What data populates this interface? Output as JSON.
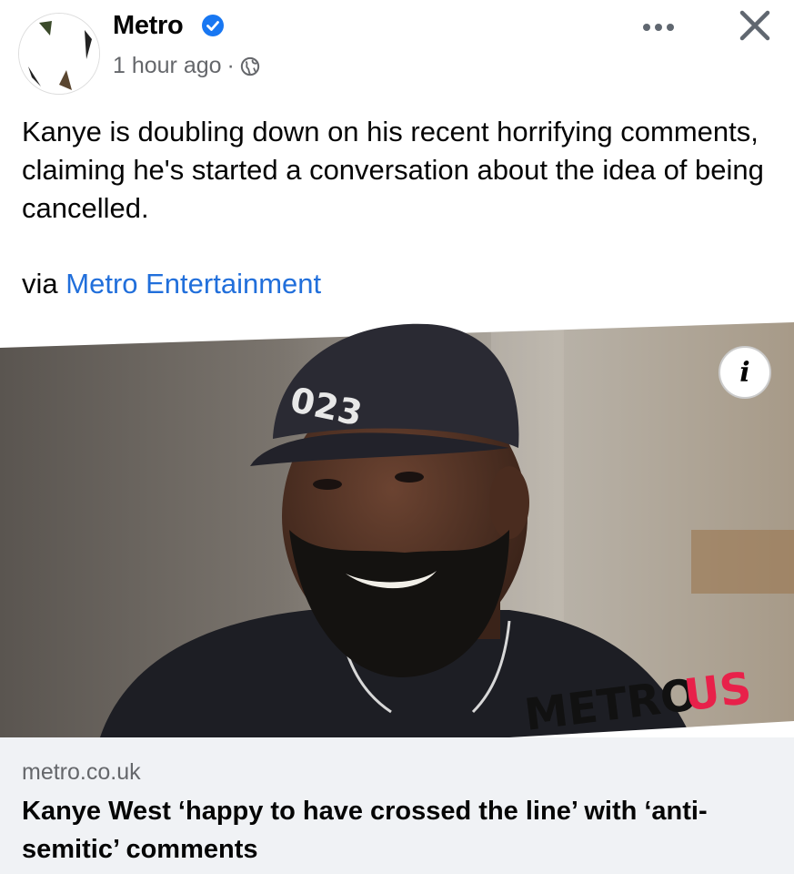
{
  "post": {
    "page_name": "Metro",
    "time": "1 hour ago",
    "separator": "·",
    "text": "Kanye is doubling down on his recent horrifying comments, claiming he's started a conversation about the idea of being cancelled.",
    "via_prefix": "via",
    "via_link": "Metro Entertainment"
  },
  "media": {
    "cap_text": "023",
    "logo_part1": "METRO",
    "logo_part2": "US",
    "info_label": "i"
  },
  "link_card": {
    "domain": "metro.co.uk",
    "headline": "Kanye West ‘happy to have crossed the line’ with ‘anti-semitic’ comments"
  },
  "colors": {
    "link_blue": "#216fdb",
    "verified_blue": "#1877f2",
    "secondary_text": "#65676b",
    "logo_red": "#e8214a"
  },
  "icons": [
    "verified-badge-icon",
    "globe-icon",
    "more-options-icon",
    "close-icon",
    "info-icon"
  ]
}
